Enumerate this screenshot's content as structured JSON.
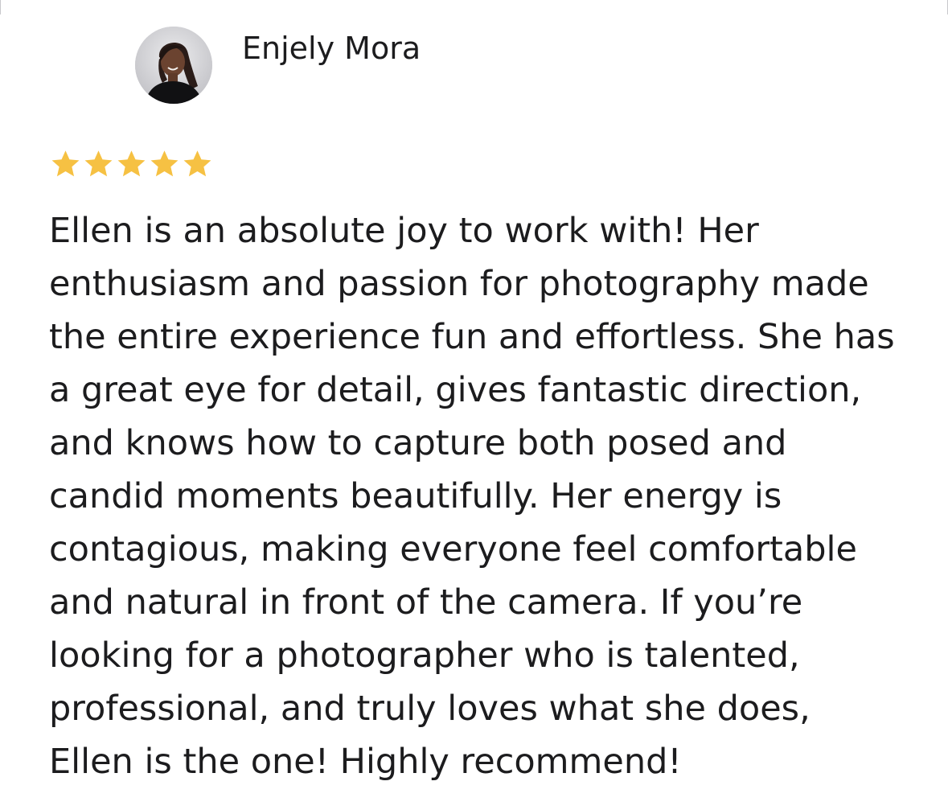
{
  "review": {
    "reviewer_name": "Enjely Mora",
    "rating": 5,
    "rating_max": 5,
    "star_color": "#f6c143",
    "text_lines": [
      "Ellen is an absolute joy to work with! Her",
      "enthusiasm and passion for photography made",
      "the entire experience fun and effortless. She has",
      "a great eye for detail, gives fantastic direction,",
      "and knows how to capture both posed and",
      "candid moments beautifully. Her energy is",
      "contagious, making everyone feel comfortable",
      "and natural in front of the camera. If you’re",
      "looking for a photographer who is talented,",
      "professional, and truly loves what she does,",
      "Ellen is the one! Highly recommend!"
    ]
  },
  "icons": {
    "avatar": "avatar-photo",
    "star": "star-icon"
  }
}
